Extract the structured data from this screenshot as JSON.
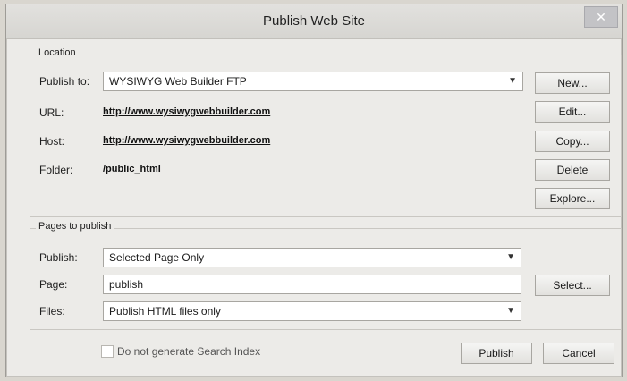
{
  "window": {
    "title": "Publish Web Site",
    "close_glyph": "✕"
  },
  "location": {
    "group_title": "Location",
    "publish_to_label": "Publish to:",
    "publish_to_value": "WYSIWYG Web Builder FTP",
    "url_label": "URL:",
    "url_value": "http://www.wysiwygwebbuilder.com",
    "host_label": "Host:",
    "host_value": "http://www.wysiwygwebbuilder.com",
    "folder_label": "Folder:",
    "folder_value": "/public_html"
  },
  "location_buttons": {
    "new": "New...",
    "edit": "Edit...",
    "copy": "Copy...",
    "delete": "Delete",
    "explore": "Explore..."
  },
  "pages": {
    "group_title": "Pages to publish",
    "publish_label": "Publish:",
    "publish_value": "Selected Page Only",
    "page_label": "Page:",
    "page_value": "publish",
    "files_label": "Files:",
    "files_value": "Publish HTML files only",
    "select_button": "Select..."
  },
  "footer": {
    "checkbox_label": "Do not generate Search Index",
    "checkbox_checked": false,
    "publish_button": "Publish",
    "cancel_button": "Cancel"
  },
  "icons": {
    "dropdown": "chevron-down-icon",
    "close": "close-icon"
  }
}
